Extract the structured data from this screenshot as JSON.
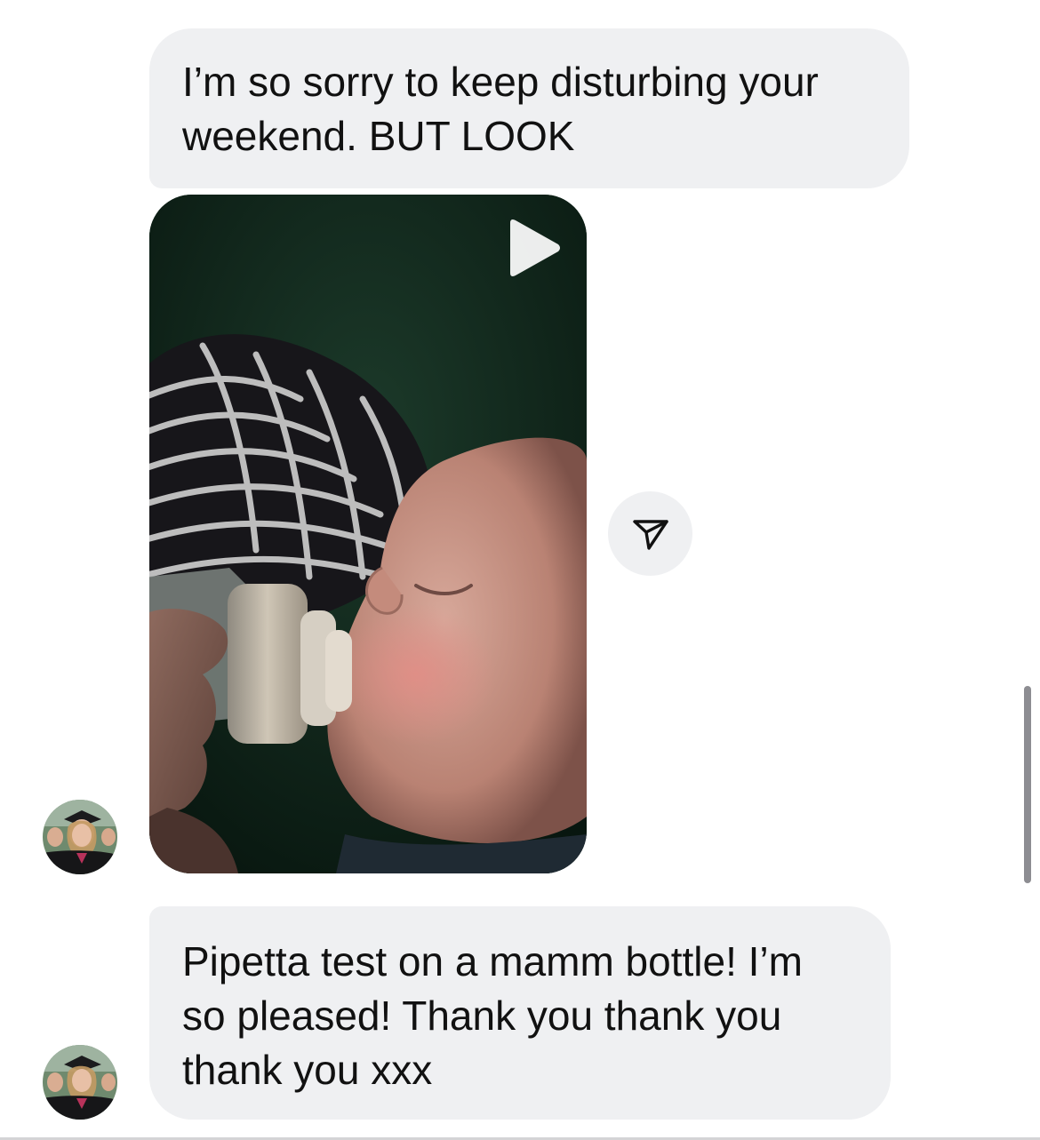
{
  "conversation": {
    "messages": [
      {
        "type": "text",
        "text": "I’m so sorry to keep disturbing your\nweekend. BUT LOOK"
      },
      {
        "type": "video",
        "play_icon": "play-icon",
        "share_icon": "paper-plane-icon"
      },
      {
        "type": "text",
        "text": "Pipetta test on a mamm bottle! I’m\nso pleased! Thank you thank you\nthank you xxx"
      }
    ],
    "sender_avatar_icon": "profile-photo-avatar"
  },
  "colors": {
    "bubble_background": "#eff0f2",
    "text": "#111111",
    "scrollbar": "#8d8d92"
  }
}
